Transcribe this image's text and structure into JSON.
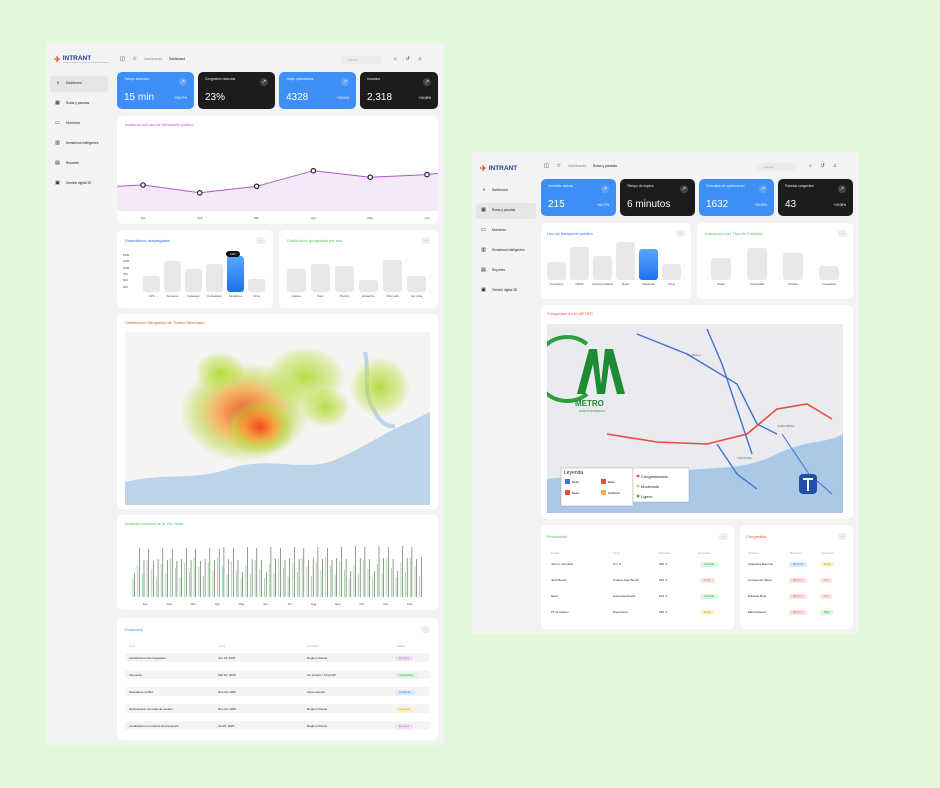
{
  "dashboard": {
    "logo": "INTRANT",
    "logo_sub": "Instituto Nacional de Transito y Transporte Terrestre",
    "nav": [
      "Dashboard",
      "Rutas y paradas",
      "Monitoreo",
      "Semáforos inteligentes",
      "Reportes",
      "Gemelo digital 3D"
    ],
    "breadcrumb": [
      "Dashboards",
      "Dashboard"
    ],
    "search_placeholder": "Search",
    "kpis": [
      {
        "label": "Tiempo ahorrado",
        "value": "15 min",
        "change": "+36.07%",
        "style": "blue"
      },
      {
        "label": "Congestion reducida",
        "value": "23%",
        "change": "",
        "style": "dark"
      },
      {
        "label": "Viajes optimizados",
        "value": "4328",
        "change": "+15.03%",
        "style": "blue"
      },
      {
        "label": "Usuarios",
        "value": "2,318",
        "change": "+16.08%",
        "style": "dark"
      }
    ],
    "usage_title": "Aumento del uso de transporte publico",
    "devices_title": "Dispositivos desplegados",
    "geo_title": "Distribución geografica por uso",
    "heat_title": "Distribución Geografica de Trafico Detectado",
    "green_title": "Impacto mensual de la Via Verde",
    "projects_title": "Proyectos",
    "projects_headers": [
      "Titulo",
      "Fecha",
      "Ubicacion",
      "Estado"
    ],
    "projects": [
      {
        "title": "Visualización de congestión",
        "date": "Jun 24, 2025",
        "loc": "Region Ozama",
        "status": "En curso",
        "color": "purple"
      },
      {
        "title": "Via verde",
        "date": "Mar 10, 2025",
        "loc": "Av. Lincoln / Churchill",
        "status": "Completado",
        "color": "green"
      },
      {
        "title": "Semaforos iot Bot",
        "date": "Nov 10, 2025",
        "loc": "Zona oriental",
        "status": "Pendiente",
        "color": "blue"
      },
      {
        "title": "Optimizacion de rutas de usuario",
        "date": "Dec 20, 2025",
        "loc": "Region Ozama",
        "status": "Aprobado",
        "color": "yellow"
      },
      {
        "title": "Localizacion en mantos de transporte",
        "date": "Jul 25, 2025",
        "loc": "Region Ozama",
        "status": "En curso",
        "color": "purple"
      }
    ]
  },
  "rutas": {
    "logo": "INTRANT",
    "nav": [
      "Dashboard",
      "Rutas y paradas",
      "Monitoreo",
      "Semaforos inteligentes",
      "Reportes",
      "Gemelo digital 3D"
    ],
    "breadcrumb": [
      "Dashboards",
      "Rutas y paradas"
    ],
    "search_placeholder": "Search",
    "kpis": [
      {
        "label": "Unidades activas",
        "value": "215",
        "change": "+36.07%",
        "style": "blue"
      },
      {
        "label": "Tiempo de espera",
        "value": "6 minutos",
        "change": "",
        "style": "dark"
      },
      {
        "label": "Consultas de optimizacion",
        "value": "1632",
        "change": "+35.03%",
        "style": "blue"
      },
      {
        "label": "Paradas congestion",
        "value": "43",
        "change": "+15.06%",
        "style": "dark"
      }
    ],
    "uso_title": "Uso de transporte publico",
    "inter_title": "Interacción por Tipo de Consulta",
    "metro_title": "Congestion en el METRO",
    "metro_logo_text": "METRO",
    "metro_logo_sub": "SANTO DOMINGO",
    "legend_title": "Leyenda",
    "legend_items": [
      {
        "label": "Congestionado",
        "color": "#e74c3c"
      },
      {
        "label": "Moderado",
        "color": "#f5b041"
      },
      {
        "label": "Ligero",
        "color": "#3cb043"
      }
    ],
    "map_keys": [
      "Metro",
      "Metro",
      "Metro",
      "Teleferico"
    ],
    "map_places": [
      "LA MELLA",
      "ALMA ROSA",
      "COLONIAL"
    ],
    "prox_title": "Proximidad",
    "prox_headers": [
      "Parada",
      "Sector",
      "Distancia",
      "Congestion"
    ],
    "prox": [
      {
        "parada": "John F. Kennedy",
        "sector": "Km. 9",
        "dist": "450 m",
        "status": "Correcta",
        "color": "green"
      },
      {
        "parada": "Juan Bosch",
        "sector": "Ciudad Juan Bosch",
        "dist": "540 m",
        "status": "Lento",
        "color": "red"
      },
      {
        "parada": "Naco",
        "sector": "Autopista Duarte",
        "dist": "212 m",
        "status": "Correcta",
        "color": "green"
      },
      {
        "parada": "27 de febrero",
        "sector": "Hipodromo",
        "dist": "295 m",
        "status": "Medio",
        "color": "yellow"
      }
    ],
    "cong_title": "Congestión",
    "cong_headers": [
      "Estacion",
      "Metrolinea",
      "Congestion"
    ],
    "cong": [
      {
        "est": "Casandra Damiron",
        "linea": "Metro L1",
        "status": "Medio",
        "lc": "blue",
        "c": "yellow"
      },
      {
        "est": "Concepcion Bona",
        "linea": "Metro L1",
        "status": "Alto",
        "lc": "red",
        "c": "red"
      },
      {
        "est": "Eduardo Brito",
        "linea": "Metro L1",
        "status": "Alto",
        "lc": "red",
        "c": "red"
      },
      {
        "est": "Maria Montez",
        "linea": "Metro L1",
        "status": "Bajo",
        "lc": "red",
        "c": "green"
      }
    ]
  },
  "chart_data": [
    {
      "type": "line",
      "title": "Aumento del uso de transporte publico",
      "categories": [
        "Jan",
        "Feb",
        "Mar",
        "Apr",
        "May",
        "Jun"
      ],
      "values": [
        40,
        28,
        38,
        62,
        52,
        56
      ],
      "ylim": [
        0,
        100
      ]
    },
    {
      "type": "bar",
      "title": "Dispositivos desplegados",
      "categories": [
        "GPS",
        "Sensores",
        "Gateways",
        "Contadores",
        "Semáforos",
        "Otros"
      ],
      "values": [
        500,
        950,
        700,
        850,
        1112,
        400
      ],
      "highlight": "Semáforos",
      "tooltip": "1112",
      "yticks": [
        "1500",
        "1250",
        "1000",
        "750",
        "500",
        "250"
      ],
      "ylim": [
        0,
        1500
      ]
    },
    {
      "type": "bar",
      "title": "Distribución geografica por uso",
      "categories": [
        "Gascue",
        "Naco",
        "Piantini",
        "Ensanche",
        "Villa mella",
        "Los mina"
      ],
      "values": [
        55,
        68,
        63,
        30,
        78,
        40
      ]
    },
    {
      "type": "heatmap",
      "title": "Distribución Geografica de Trafico Detectado"
    },
    {
      "type": "bar",
      "title": "Impacto mensual de la Via Verde",
      "categories": [
        "Jan",
        "Feb",
        "Mar",
        "Apr",
        "May",
        "Jun",
        "Jul",
        "Aug",
        "Sep",
        "Oct",
        "Nov",
        "Dec"
      ]
    },
    {
      "type": "bar",
      "title": "Uso de transporte publico",
      "categories": [
        "Corredores",
        "OMSA",
        "Carritos publicos",
        "Metro",
        "Voladoras",
        "Otros"
      ],
      "values": [
        35,
        62,
        45,
        72,
        58,
        30
      ],
      "highlight": "Voladoras"
    },
    {
      "type": "bar",
      "title": "Interacción por Tipo de Consulta",
      "categories": [
        "Rutas",
        "Proximidad",
        "Parada",
        "Congestion"
      ],
      "values": [
        45,
        65,
        55,
        28
      ]
    }
  ],
  "colors": {
    "accent": "#3d8ff5",
    "dark": "#1c1c1c",
    "line": "#b554d6",
    "bg": "#e2f8dd"
  }
}
